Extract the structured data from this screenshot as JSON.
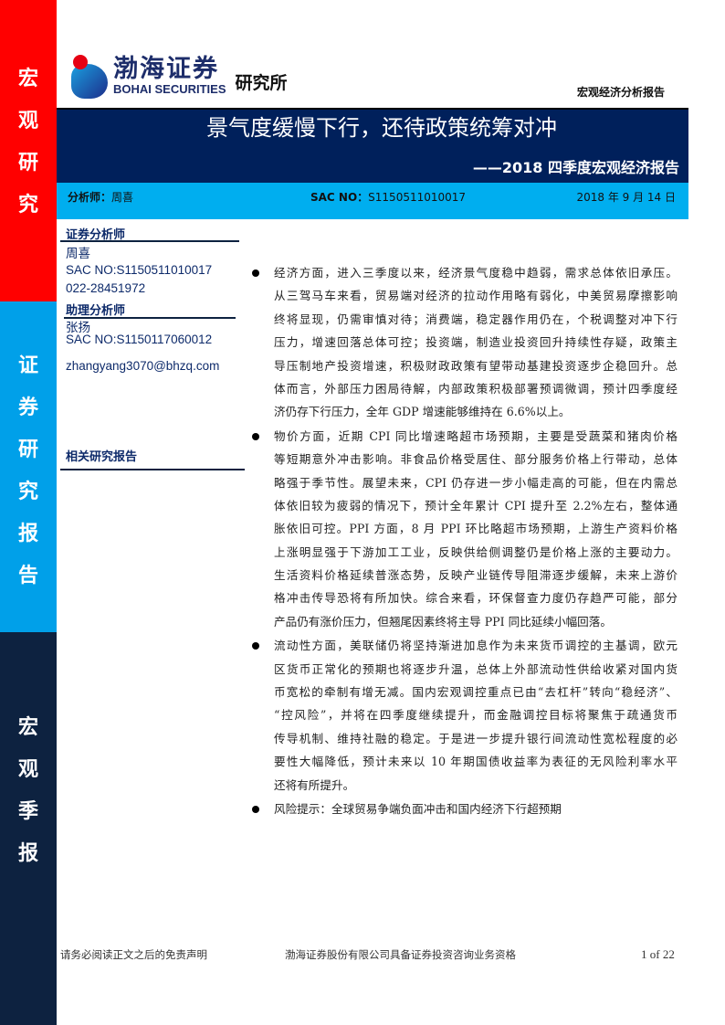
{
  "sidebar": {
    "top": [
      "宏",
      "观",
      "研",
      "究"
    ],
    "middle": [
      "证",
      "券",
      "研",
      "究",
      "报",
      "告"
    ],
    "bottom": [
      "宏",
      "观",
      "季",
      "报"
    ]
  },
  "logo": {
    "cn": "渤海证券",
    "en": "BOHAI SECURITIES",
    "institute": "研究所"
  },
  "report_type": "宏观经济分析报告",
  "title": "景气度缓慢下行，还待政策统筹对冲",
  "subtitle": "——2018 四季度宏观经济报告",
  "info": {
    "analyst_label": "分析师：",
    "analyst": "周喜",
    "sac_label": "SAC NO：",
    "sac": "S1150511010017",
    "date": "2018 年 9 月 14 日"
  },
  "left": {
    "analyst_heading": "证券分析师",
    "analyst_name": "周喜",
    "analyst_sac": "SAC NO:S1150511010017",
    "analyst_phone": "022-28451972",
    "assistant_heading": "助理分析师",
    "assistant_name": "张扬",
    "assistant_sac": "SAC NO:S1150117060012",
    "assistant_email": "zhangyang3070@bhzq.com",
    "related_heading": "相关研究报告"
  },
  "paragraphs": [
    [
      "经济方面，进入三季度以来，经济景气度稳中趋弱，需求总体依旧承压。",
      "从三驾马车来看，贸易端对经济的拉动作用略有弱化，中美贸易摩擦影响",
      "终将显现，仍需审慎对待；消费端，稳定器作用仍在，个税调整对冲下行",
      "压力，增速回落总体可控；投资端，制造业投资回升持续性存疑，政策主",
      "导压制地产投资增速，积极财政政策有望带动基建投资逐步企稳回升。总",
      "体而言，外部压力困局待解，内部政策积极部署预调微调，预计四季度经",
      "济仍存下行压力，全年 GDP 增速能够维持在 6.6%以上。"
    ],
    [
      "物价方面，近期 CPI 同比增速略超市场预期，主要是受蔬菜和猪肉价格",
      "等短期意外冲击影响。非食品价格受居住、部分服务价格上行带动，总体",
      "略强于季节性。展望未来，CPI 仍存进一步小幅走高的可能，但在内需总",
      "体依旧较为疲弱的情况下，预计全年累计 CPI 提升至 2.2%左右，整体通",
      "胀依旧可控。PPI 方面，8 月 PPI 环比略超市场预期，上游生产资料价格",
      "上涨明显强于下游加工工业，反映供给侧调整仍是价格上涨的主要动力。",
      "生活资料价格延续普涨态势，反映产业链传导阻滞逐步缓解，未来上游价",
      "格冲击传导恐将有所加快。综合来看，环保督查力度仍存趋严可能，部分",
      "产品仍有涨价压力，但翘尾因素终将主导 PPI 同比延续小幅回落。"
    ],
    [
      "流动性方面，美联储仍将坚持渐进加息作为未来货币调控的主基调，欧元",
      "区货币正常化的预期也将逐步升温，总体上外部流动性供给收紧对国内货",
      "币宽松的牵制有增无减。国内宏观调控重点已由“去杠杆”转向“稳经济”、",
      "“控风险”，并将在四季度继续提升，而金融调控目标将聚焦于疏通货币",
      "传导机制、维持社融的稳定。于是进一步提升银行间流动性宽松程度的必",
      "要性大幅降低，预计未来以 10 年期国债收益率为表征的无风险利率水平",
      "还将有所提升。"
    ],
    [
      "风险提示：全球贸易争端负面冲击和国内经济下行超预期"
    ]
  ],
  "footer": {
    "disclaimer": "请务必阅读正文之后的免责声明",
    "qualification": "渤海证券股份有限公司具备证券投资咨询业务资格",
    "page": "1  of  22"
  }
}
